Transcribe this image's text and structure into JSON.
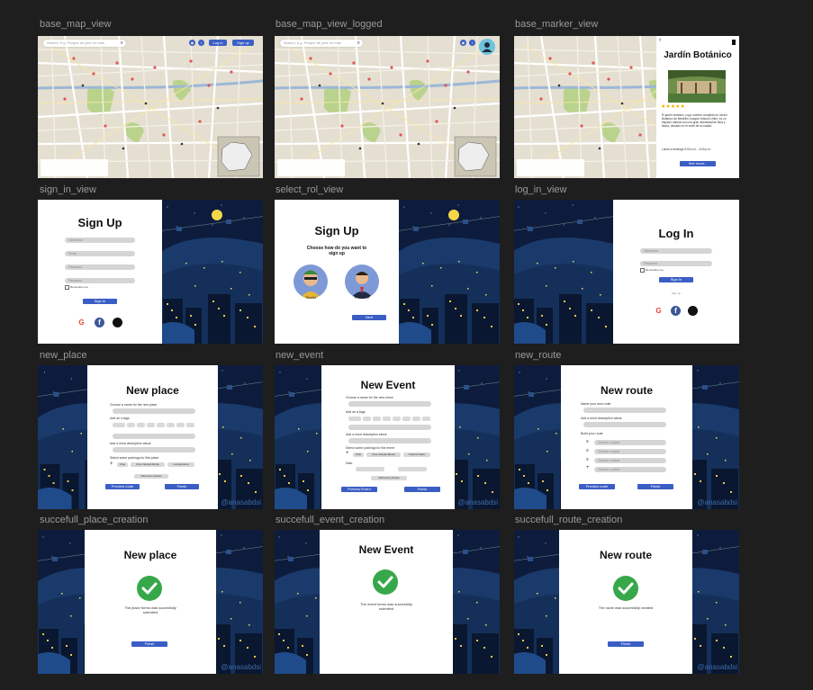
{
  "frames": [
    {
      "id": "base_map_view",
      "label": "base_map_view"
    },
    {
      "id": "base_map_view_logged",
      "label": "base_map_view_logged"
    },
    {
      "id": "base_marker_view",
      "label": "base_marker_view"
    },
    {
      "id": "sign_in_view",
      "label": "sign_in_view"
    },
    {
      "id": "select_rol_view",
      "label": "select_rol_view"
    },
    {
      "id": "log_in_view",
      "label": "log_in_view"
    },
    {
      "id": "new_place",
      "label": "new_place"
    },
    {
      "id": "new_event",
      "label": "new_event"
    },
    {
      "id": "new_route",
      "label": "new_route"
    },
    {
      "id": "succefull_place_creation",
      "label": "succefull_place_creation"
    },
    {
      "id": "succefull_event_creation",
      "label": "succefull_event_creation"
    },
    {
      "id": "succefull_route_creation",
      "label": "succefull_route_creation"
    }
  ],
  "map": {
    "search_placeholder": "Search, e.g. Parque de pies no mas",
    "login_label": "Log in",
    "signup_label": "Sign up"
  },
  "marker": {
    "title": "Jardín Botánico",
    "rating": "★★★★★",
    "description": "El jardín botánico, cuyo nombre completo es Jardín Botánico de Medellín Joaquín Antonio Uribe, es un espacio natural con una gran diversidad de flora y fauna, ubicado en el norte de la ciudad.",
    "hours": "Lunes a domingo 9:00 a.m. - 4:00 p.m.",
    "see_more": "See more..."
  },
  "signup": {
    "title": "Sign Up",
    "fields": [
      "Username",
      "Email",
      "Password",
      "Password"
    ],
    "remember": "Remember me",
    "button": "Sign In"
  },
  "select_rol": {
    "title": "Sign Up",
    "subtitle": "Choose how do you want to sign up",
    "role1": "Tourist",
    "role2": "Promotor",
    "button": "Next"
  },
  "login": {
    "title": "Log In",
    "fields": [
      "Username",
      "Password"
    ],
    "remember": "Remember me",
    "button": "Sign In",
    "signup_link": "Sign up"
  },
  "new_place": {
    "title": "New place",
    "name_label": "Choose a name for the new place",
    "tags_label": "Add an a tags",
    "desc_label": "Add a short description about",
    "parking_label": "Select some parkings for this place",
    "chips": [
      "Cine",
      "Cine independiente",
      "Lanzamiento"
    ],
    "add_photo": "Add some photos",
    "preview": "Preview route",
    "finish": "Finish"
  },
  "new_event": {
    "title": "New Event",
    "name_label": "Choose a name for the new event",
    "tags_label": "Add an a tags",
    "desc_label": "Add a short description about",
    "parking_label": "Select some parkings for the event",
    "chips": [
      "Cine",
      "Cine independiente",
      "Cultura Otaku"
    ],
    "date_label": "Date",
    "add_photo": "Add some photos",
    "preview": "Preview Event",
    "finish": "Finish"
  },
  "new_route": {
    "title": "New route",
    "name_label": "Name your new route",
    "desc_label": "Add a short description about",
    "build_label": "Build your route",
    "stops": [
      "Choose a place",
      "Choose a place",
      "Choose a place",
      "Choose a place"
    ],
    "preview": "Preview route",
    "finish": "Finish"
  },
  "success_place": {
    "title": "New place",
    "message": "The place forms was succesfully submited",
    "button": "Finish"
  },
  "success_event": {
    "title": "New Event",
    "message": "The event forms was succesfully submited",
    "button": "Finish"
  },
  "success_route": {
    "title": "New route",
    "message": "The route was succesfully created",
    "button": "Finish"
  },
  "watermark": "@anasabdsi"
}
